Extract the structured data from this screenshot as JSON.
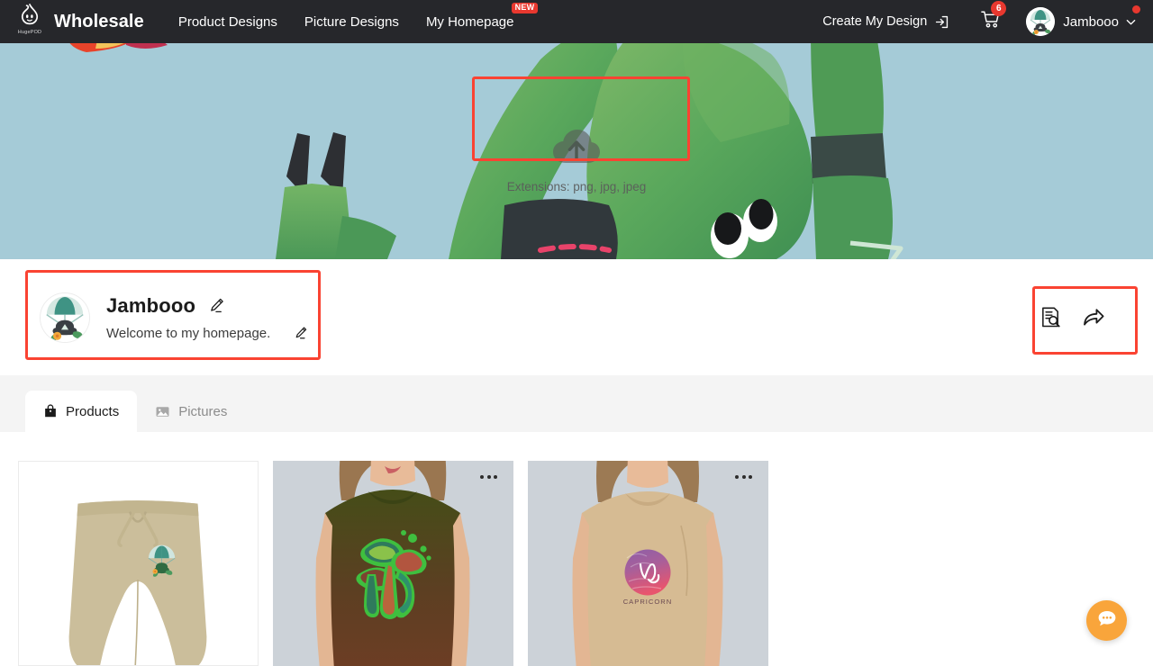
{
  "header": {
    "logo_wordmark": "HugePOD",
    "brand": "Wholesale",
    "nav": [
      {
        "label": "Product Designs",
        "badge": ""
      },
      {
        "label": "Picture Designs",
        "badge": ""
      },
      {
        "label": "My Homepage",
        "badge": "NEW"
      }
    ],
    "create_design_label": "Create My Design",
    "cart_count": "6",
    "user_name": "Jambooo",
    "icons": {
      "logo": "hugepod-logo-icon",
      "login_arrow": "login-arrow-icon",
      "cart": "cart-icon",
      "chevron": "chevron-down-icon"
    }
  },
  "banner": {
    "upload_hint": "Extensions: png, jpg, jpeg",
    "upload_icon": "cloud-upload-icon",
    "bg_color": "#a5cbd7"
  },
  "profile": {
    "name": "Jambooo",
    "bio": "Welcome to my homepage.",
    "edit_icon": "pencil-edit-icon",
    "actions": [
      {
        "name": "preview-icon"
      },
      {
        "name": "share-icon"
      }
    ]
  },
  "tabs": [
    {
      "label": "Products",
      "icon": "bag-icon",
      "active": true
    },
    {
      "label": "Pictures",
      "icon": "image-icon",
      "active": false
    }
  ],
  "products": [
    {
      "name": "khaki-shorts-parachute",
      "menu": false
    },
    {
      "name": "olive-tshirt-mushrooms",
      "menu": true
    },
    {
      "name": "tan-tshirt-capricorn",
      "menu": true
    }
  ],
  "chat": {
    "icon": "chat-bubble-icon",
    "color": "#f9a53b"
  },
  "highlights": {
    "accent": "#fa4332",
    "boxes": [
      "banner-upload-area",
      "profile-card",
      "profile-actions"
    ]
  }
}
